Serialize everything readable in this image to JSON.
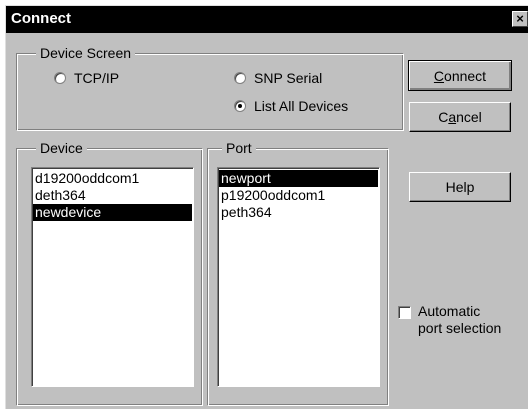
{
  "window": {
    "title": "Connect",
    "close_glyph": "×"
  },
  "device_screen": {
    "label": "Device Screen",
    "options": [
      {
        "label": "TCP/IP",
        "checked": false
      },
      {
        "label": "SNP Serial",
        "checked": false
      },
      {
        "label": "List All Devices",
        "checked": true
      }
    ]
  },
  "buttons": {
    "connect": {
      "pre": "",
      "accel": "C",
      "post": "onnect"
    },
    "cancel": {
      "pre": "C",
      "accel": "a",
      "post": "ncel"
    },
    "help": "Help"
  },
  "device": {
    "label": "Device",
    "items": [
      "d19200oddcom1",
      "deth364",
      "newdevice"
    ],
    "selected": "newdevice"
  },
  "port": {
    "label": "Port",
    "items": [
      "newport",
      "p19200oddcom1",
      "peth364"
    ],
    "selected": "newport"
  },
  "auto_port": {
    "line1": "Automatic",
    "line2": "port selection",
    "checked": false
  }
}
